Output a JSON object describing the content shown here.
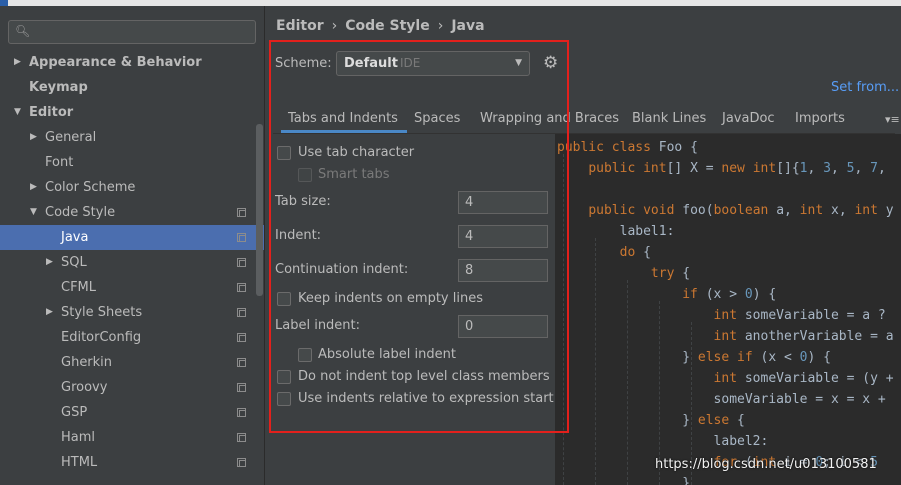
{
  "sidebar": {
    "search_placeholder": "",
    "items": [
      {
        "label": "Appearance & Behavior",
        "level": 0,
        "bold": true,
        "arrow": "▶",
        "copy": false,
        "selected": false
      },
      {
        "label": "Keymap",
        "level": 0,
        "bold": true,
        "arrow": "",
        "copy": false,
        "selected": false
      },
      {
        "label": "Editor",
        "level": 0,
        "bold": true,
        "arrow": "▼",
        "copy": false,
        "selected": false
      },
      {
        "label": "General",
        "level": 1,
        "bold": false,
        "arrow": "▶",
        "copy": false,
        "selected": false
      },
      {
        "label": "Font",
        "level": 1,
        "bold": false,
        "arrow": "",
        "copy": false,
        "selected": false
      },
      {
        "label": "Color Scheme",
        "level": 1,
        "bold": false,
        "arrow": "▶",
        "copy": false,
        "selected": false
      },
      {
        "label": "Code Style",
        "level": 1,
        "bold": false,
        "arrow": "▼",
        "copy": true,
        "selected": false
      },
      {
        "label": "Java",
        "level": 2,
        "bold": false,
        "arrow": "",
        "copy": true,
        "selected": true
      },
      {
        "label": "SQL",
        "level": 2,
        "bold": false,
        "arrow": "▶",
        "copy": true,
        "selected": false
      },
      {
        "label": "CFML",
        "level": 2,
        "bold": false,
        "arrow": "",
        "copy": true,
        "selected": false
      },
      {
        "label": "Style Sheets",
        "level": 2,
        "bold": false,
        "arrow": "▶",
        "copy": true,
        "selected": false
      },
      {
        "label": "EditorConfig",
        "level": 2,
        "bold": false,
        "arrow": "",
        "copy": true,
        "selected": false
      },
      {
        "label": "Gherkin",
        "level": 2,
        "bold": false,
        "arrow": "",
        "copy": true,
        "selected": false
      },
      {
        "label": "Groovy",
        "level": 2,
        "bold": false,
        "arrow": "",
        "copy": true,
        "selected": false
      },
      {
        "label": "GSP",
        "level": 2,
        "bold": false,
        "arrow": "",
        "copy": true,
        "selected": false
      },
      {
        "label": "Haml",
        "level": 2,
        "bold": false,
        "arrow": "",
        "copy": true,
        "selected": false
      },
      {
        "label": "HTML",
        "level": 2,
        "bold": false,
        "arrow": "",
        "copy": true,
        "selected": false
      }
    ]
  },
  "breadcrumb": [
    "Editor",
    "Code Style",
    "Java"
  ],
  "breadcrumb_sep": "›",
  "scheme": {
    "label": "Scheme:",
    "name": "Default",
    "sub": "IDE"
  },
  "set_from": "Set from...",
  "tabs": [
    "Tabs and Indents",
    "Spaces",
    "Wrapping and Braces",
    "Blank Lines",
    "JavaDoc",
    "Imports"
  ],
  "active_tab": "Tabs and Indents",
  "options": {
    "use_tab_character": {
      "label": "Use tab character",
      "checked": false
    },
    "smart_tabs": {
      "label": "Smart tabs",
      "checked": false,
      "disabled": true
    },
    "tab_size": {
      "label": "Tab size:",
      "value": "4"
    },
    "indent": {
      "label": "Indent:",
      "value": "4"
    },
    "continuation_indent": {
      "label": "Continuation indent:",
      "value": "8"
    },
    "keep_indents_empty": {
      "label": "Keep indents on empty lines",
      "checked": false
    },
    "label_indent": {
      "label": "Label indent:",
      "value": "0"
    },
    "absolute_label_indent": {
      "label": "Absolute label indent",
      "checked": false
    },
    "no_indent_top_level": {
      "label": "Do not indent top level class members",
      "checked": false
    },
    "indents_relative": {
      "label": "Use indents relative to expression start",
      "checked": false
    }
  },
  "code_lines": [
    "public class Foo {",
    "    public int[] X = new int[]{1, 3, 5, 7,",
    "",
    "    public void foo(boolean a, int x, int y",
    "        label1:",
    "        do {",
    "            try {",
    "                if (x > 0) {",
    "                    int someVariable = a ?",
    "                    int anotherVariable = a",
    "                } else if (x < 0) {",
    "                    int someVariable = (y +",
    "                    someVariable = x = x +",
    "                } else {",
    "                    label2:",
    "                    for (int i = 0; i < 5",
    "                }"
  ],
  "watermark": "https://blog.csdn.net/u013100581",
  "colors": {
    "accent": "#4b6eaf",
    "highlight_box": "#e3201c",
    "link": "#589df6",
    "keyword": "#cc7832",
    "number": "#6897bb"
  }
}
